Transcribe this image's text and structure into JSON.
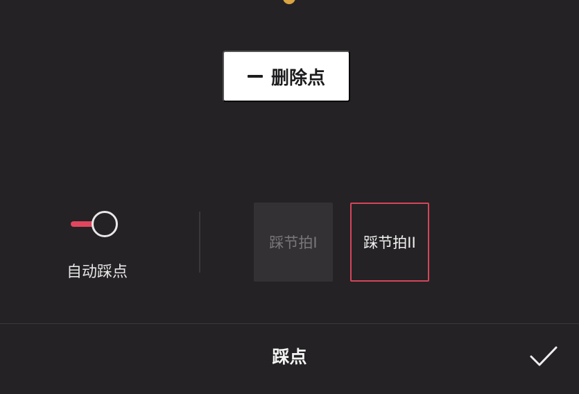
{
  "delete_point": {
    "label": "删除点",
    "icon": "minus-icon"
  },
  "auto_beat": {
    "label": "自动踩点",
    "enabled": true,
    "accent_color": "#e0475e"
  },
  "beat_options": [
    {
      "label": "踩节拍I",
      "selected": false
    },
    {
      "label": "踩节拍II",
      "selected": true
    }
  ],
  "bottom_bar": {
    "title": "踩点",
    "confirm_icon": "check-icon"
  },
  "colors": {
    "background": "#242224",
    "selected_border": "#d6455b"
  }
}
